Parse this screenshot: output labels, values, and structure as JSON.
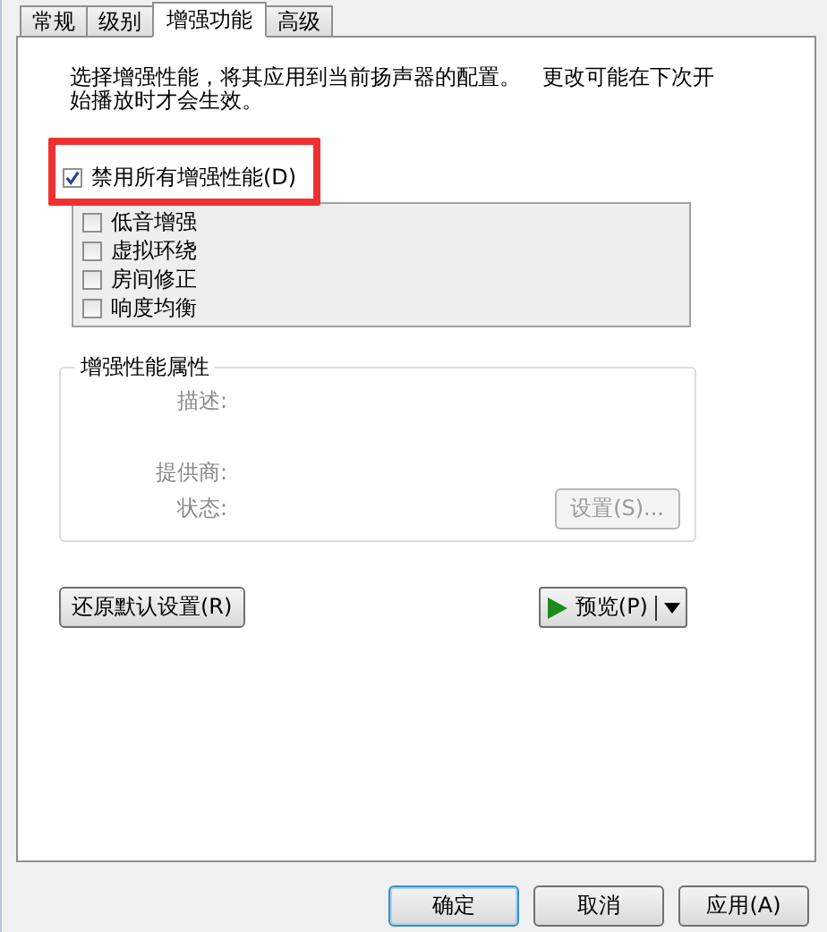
{
  "tabs": [
    {
      "label": "常规",
      "selected": false
    },
    {
      "label": "级别",
      "selected": false
    },
    {
      "label": "增强功能",
      "selected": true
    },
    {
      "label": "高级",
      "selected": false
    }
  ],
  "intro": "选择增强性能，将其应用到当前扬声器的配置。　更改可能在下次开始播放时才会生效。",
  "disable_all": {
    "label": "禁用所有增强性能(D)",
    "checked": true
  },
  "enhancements": [
    {
      "label": "低音增强",
      "checked": false
    },
    {
      "label": "虚拟环绕",
      "checked": false
    },
    {
      "label": "房间修正",
      "checked": false
    },
    {
      "label": "响度均衡",
      "checked": false
    }
  ],
  "properties": {
    "title": "增强性能属性",
    "description_label": "描述:",
    "provider_label": "提供商:",
    "status_label": "状态:",
    "settings_button": {
      "label": "设置(S)...",
      "disabled": true
    }
  },
  "restore_button": "还原默认设置(R)",
  "preview_button": "预览(P)",
  "buttons": [
    {
      "label": "确定",
      "kind": "default"
    },
    {
      "label": "取消",
      "kind": "normal"
    },
    {
      "label": "应用(A)",
      "kind": "normal"
    }
  ]
}
